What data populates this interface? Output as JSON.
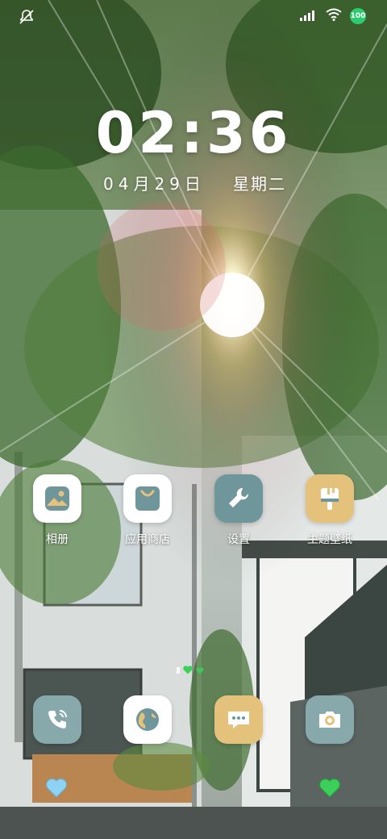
{
  "status_bar": {
    "battery_level": "100",
    "icons": [
      "notification-mute-icon",
      "signal-icon",
      "wifi-icon",
      "battery-icon"
    ]
  },
  "lockscreen": {
    "time": "02:36",
    "date": "04月29日",
    "weekday": "星期二"
  },
  "apps": [
    {
      "label": "相册",
      "icon": "gallery-icon",
      "color": "#ffffff"
    },
    {
      "label": "应用商店",
      "icon": "app-store-icon",
      "color": "#ffffff"
    },
    {
      "label": "设置",
      "icon": "settings-wrench-icon",
      "color": "#6f969a"
    },
    {
      "label": "主题壁纸",
      "icon": "theme-brush-icon",
      "color": "#e5c27b"
    }
  ],
  "dock": [
    {
      "icon": "phone-icon",
      "color": "#88a9ab"
    },
    {
      "icon": "browser-globe-icon",
      "color": "#ffffff"
    },
    {
      "icon": "messages-icon",
      "color": "#e5c27b"
    },
    {
      "icon": "camera-icon",
      "color": "#88a9ab"
    }
  ],
  "colors": {
    "accent_teal": "#5f8b92",
    "accent_gold": "#e5c27b",
    "heart_blue": "#8fd3f4",
    "heart_green": "#3ccf5a"
  }
}
